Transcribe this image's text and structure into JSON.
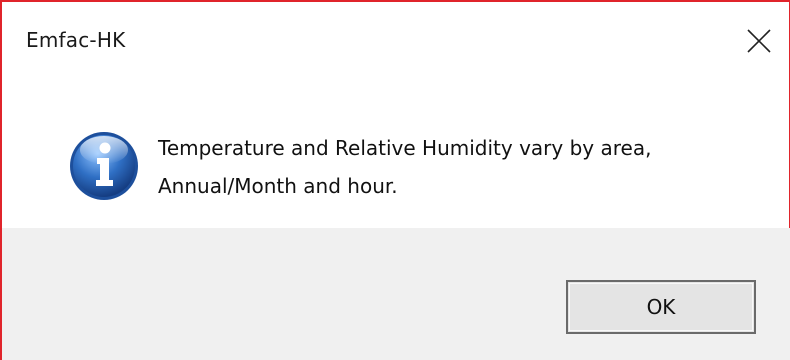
{
  "dialog": {
    "title": "Emfac-HK",
    "close_icon": "close-icon",
    "message_line1": "Temperature and Relative Humidity vary by area,",
    "message_line2": "Annual/Month and hour.",
    "info_icon": "information-icon",
    "ok_label": "OK"
  },
  "colors": {
    "border": "#e0242b",
    "footer_bg": "#f0f0f0",
    "icon_blue": "#2f6fc4"
  }
}
